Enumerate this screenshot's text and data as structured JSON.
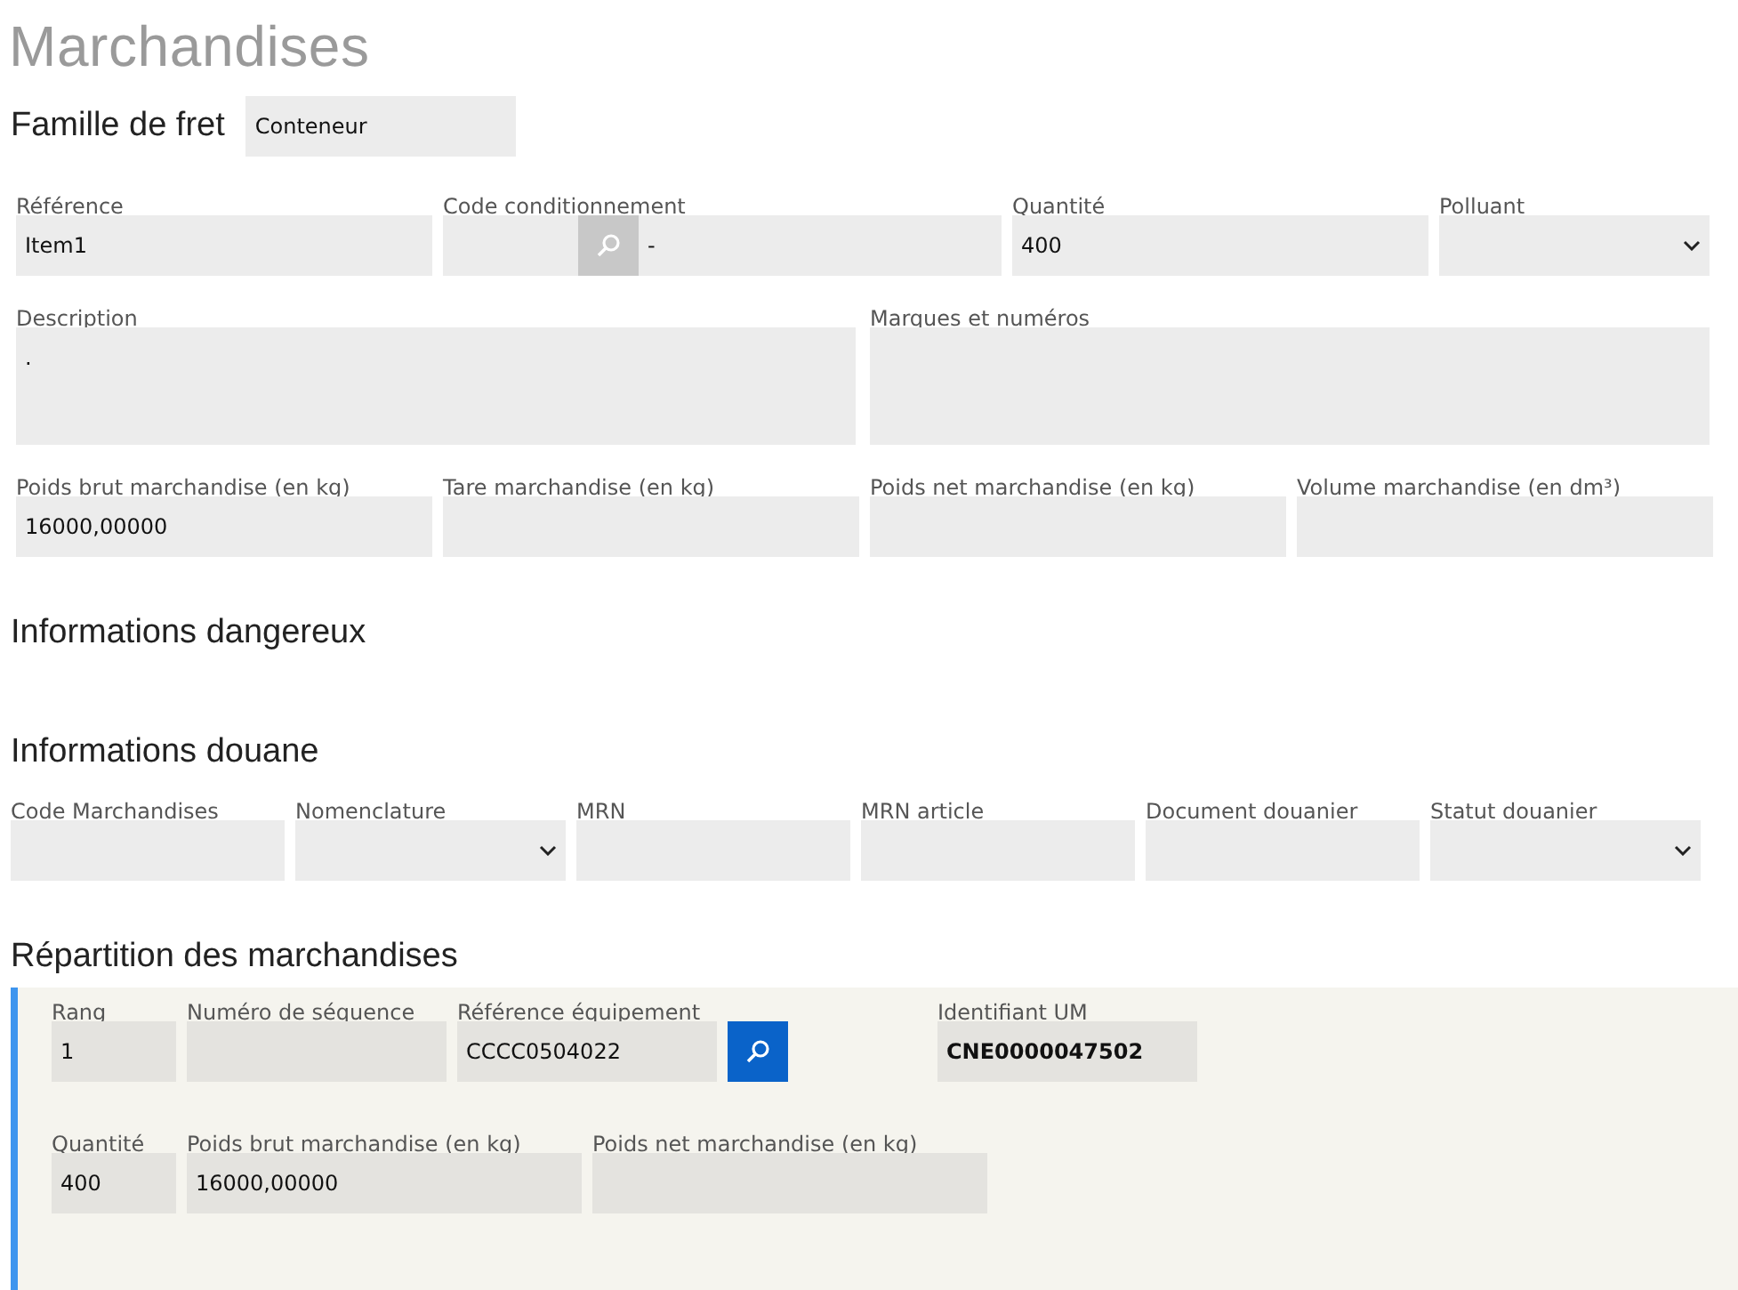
{
  "title": "Marchandises",
  "freight_family": {
    "label": "Famille de fret",
    "value": "Conteneur"
  },
  "goods_rows": [
    {
      "fields": [
        {
          "label": "Référence",
          "kind": "text",
          "value": "Item1"
        },
        {
          "label": "Code conditionnement",
          "kind": "search-inside",
          "value": "-"
        },
        {
          "label": "Quantité",
          "kind": "text",
          "value": "400"
        },
        {
          "label": "Polluant",
          "kind": "select"
        }
      ]
    },
    {
      "fields": [
        {
          "label": "Description",
          "kind": "textarea",
          "value": "."
        },
        {
          "label": "Marques et numéros",
          "kind": "textarea"
        }
      ]
    },
    {
      "fields": [
        {
          "label": "Poids brut marchandise (en kg)",
          "kind": "text",
          "value": "16000,00000"
        },
        {
          "label": "Tare marchandise (en kg)",
          "kind": "text"
        },
        {
          "label": "Poids net marchandise (en kg)",
          "kind": "text"
        },
        {
          "label": "Volume marchandise (en dm³)",
          "kind": "text"
        }
      ]
    }
  ],
  "dangerous": {
    "heading": "Informations dangereux"
  },
  "customs": {
    "heading": "Informations douane",
    "fields": [
      {
        "label": "Code Marchandises",
        "kind": "text"
      },
      {
        "label": "Nomenclature",
        "kind": "select"
      },
      {
        "label": "MRN",
        "kind": "text"
      },
      {
        "label": "MRN article",
        "kind": "text"
      },
      {
        "label": "Document douanier",
        "kind": "text"
      },
      {
        "label": "Statut douanier",
        "kind": "select"
      }
    ]
  },
  "distribution": {
    "heading": "Répartition des marchandises",
    "rows": [
      {
        "fields": [
          {
            "label": "Rang",
            "kind": "text",
            "value": "1"
          },
          {
            "label": "Numéro de séquence",
            "kind": "text"
          },
          {
            "label": "Référence équipement",
            "kind": "search-after",
            "value": "CCCC0504022"
          },
          {
            "label": "Identifiant UM",
            "kind": "bold",
            "value": "CNE0000047502"
          }
        ]
      },
      {
        "fields": [
          {
            "label": "Quantité",
            "kind": "text",
            "value": "400"
          },
          {
            "label": "Poids brut marchandise (en kg)",
            "kind": "text",
            "value": "16000,00000"
          },
          {
            "label": "Poids net marchandise (en kg)",
            "kind": "text"
          }
        ]
      }
    ]
  }
}
